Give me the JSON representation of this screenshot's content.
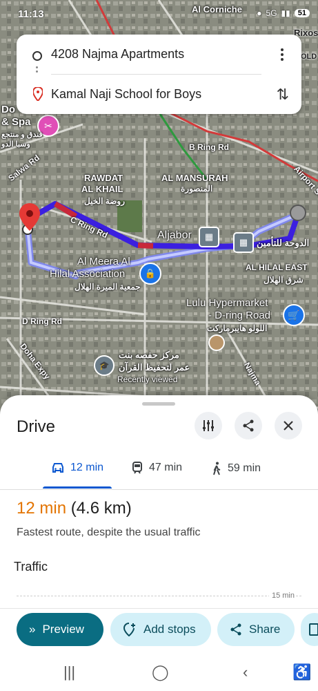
{
  "status_bar": {
    "time": "11:13",
    "network": "5G",
    "battery": "51"
  },
  "route": {
    "origin": "4208 Najma Apartments",
    "destination": "Kamal Naji School for Boys"
  },
  "map": {
    "labels": {
      "corniche": "Al Corniche",
      "rixos": "Rixos",
      "old": "OLD",
      "spa_top": "Do",
      "spa": "& Spa",
      "spa_ar": "فندق و منتجع",
      "spa_ar2": "وسبا الدو",
      "salwa": "Salwa Rd",
      "b_ring": "B Ring Rd",
      "airport": "Airport S",
      "rawdat1": "RAWDAT",
      "rawdat2": "AL KHAIL",
      "rawdat_ar": "روضة الخيل",
      "mansurah": "AL MANSURAH",
      "mansurah_ar": "المنصورة",
      "c_ring": "C Ring Rd",
      "aljabor": "Aljabor",
      "doha_insurance_ar": "الدوحة للتأمين",
      "hilal_east": "AL HILAL EAST",
      "hilal_east_ar": "شرق الهلال",
      "meera1": "Al Meera Al",
      "meera2": "Hilal Association",
      "meera_ar": "جمعية الميرة الهلال",
      "lulu1": "Lulu Hypermarket",
      "lulu2": "- D-ring Road",
      "lulu_ar": "اللولو هايبرماركت",
      "d_ring": "D Ring Rd",
      "center_ar1": "مركز حفصه بنت",
      "center_ar2": "عمر لتحفيظ القرآن",
      "recently": "Recently viewed",
      "doha_expy": "Doha Expy",
      "najma": "Najma"
    }
  },
  "sheet": {
    "title": "Drive",
    "modes": [
      {
        "label": "12 min",
        "icon": "car-icon"
      },
      {
        "label": "47 min",
        "icon": "train-icon"
      },
      {
        "label": "59 min",
        "icon": "walk-icon"
      }
    ],
    "summary_time": "12 min",
    "summary_distance": "(4.6 km)",
    "description": "Fastest route, despite the usual traffic",
    "traffic_heading": "Traffic",
    "traffic_tick": "15 min"
  },
  "actions": {
    "preview": "Preview",
    "add_stops": "Add stops",
    "share": "Share"
  },
  "colors": {
    "route": "#3b1fe0",
    "traffic_red": "#c8283a",
    "preview_bg": "#0a6d82",
    "secondary_bg": "#d3f0f8",
    "summary_orange": "#e37400"
  }
}
